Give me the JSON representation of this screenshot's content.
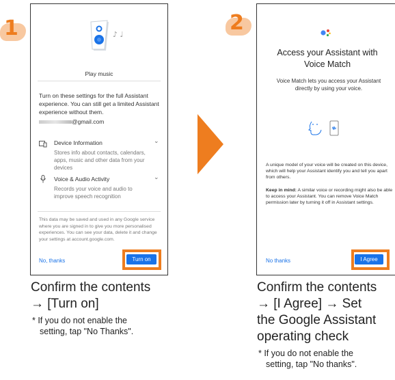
{
  "step1": {
    "badge": "1",
    "screen_title": "Play music",
    "intro": "Turn on these settings for the full Assistant experience. You can still get a limited Assistant experience without them.",
    "email": "@gmail.com",
    "device_info_title": "Device Information",
    "device_info_desc": "Stores info about contacts, calendars, apps, music and other data from your devices",
    "voice_title": "Voice & Audio Activity",
    "voice_desc": "Records your voice and audio to improve speech recognition",
    "footer": "This data may be saved and used in any Google service where you are signed in to give you more personalised experiences. You can see your data, delete it and change your settings at account.google.com.",
    "no_thanks": "No, thanks",
    "primary": "Turn on",
    "caption_line1": "Confirm the contents",
    "caption_line2": "→ [Turn on]",
    "note_line1": "* If you do not enable the",
    "note_line2": "setting, tap \"No Thanks\"."
  },
  "step2": {
    "badge": "2",
    "title_line1": "Access your Assistant with",
    "title_line2": "Voice Match",
    "intro": "Voice Match lets you access your Assistant directly by using your voice.",
    "model_text": "A unique model of your voice will be created on this device, which will help your Assistant identify you and tell you apart from others.",
    "keep_label": "Keep in mind:",
    "keep_text": " A similar voice or recording might also be able to access your Assistant. You can remove Voice Match permission later by turning it off in Assistant settings.",
    "no_thanks": "No thanks",
    "primary": "I Agree",
    "caption_line1": "Confirm the contents",
    "caption_line2": "→ [I Agree] → Set",
    "caption_line3": "the Google Assistant",
    "caption_line4": "operating check",
    "note_line1": "* If you do not enable the",
    "note_line2": "setting, tap \"No thanks\"."
  },
  "colors": {
    "accent": "#ee7d1f",
    "button": "#1a73e8"
  }
}
